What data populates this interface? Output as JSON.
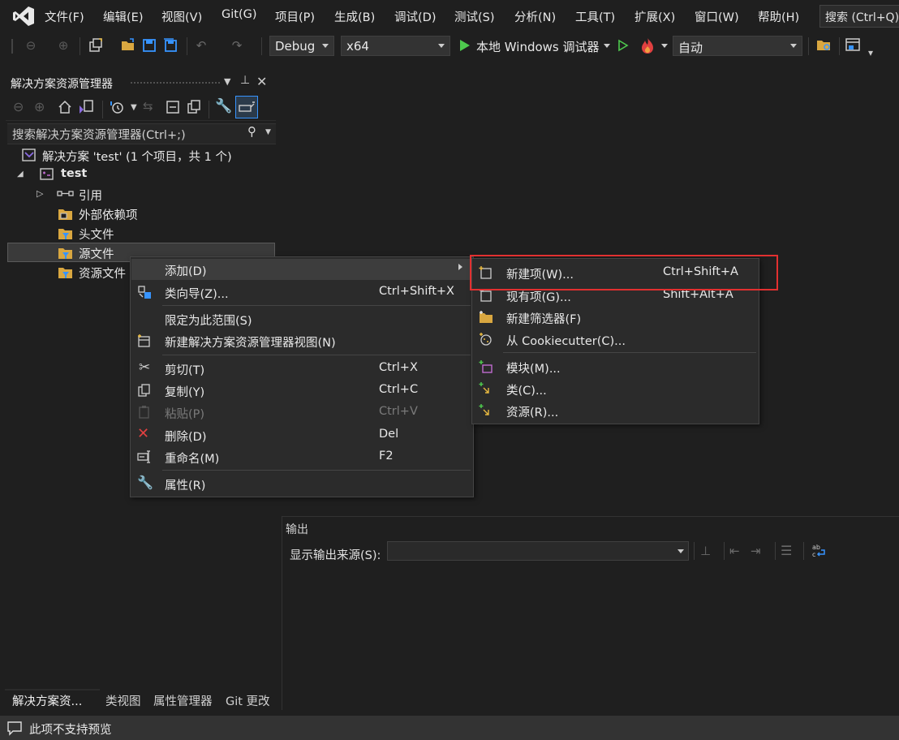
{
  "menubar": {
    "items": [
      "文件(F)",
      "编辑(E)",
      "视图(V)",
      "Git(G)",
      "项目(P)",
      "生成(B)",
      "调试(D)",
      "测试(S)",
      "分析(N)",
      "工具(T)",
      "扩展(X)",
      "窗口(W)",
      "帮助(H)"
    ],
    "search": "搜索 (Ctrl+Q)"
  },
  "toolbar": {
    "config": "Debug",
    "platform": "x64",
    "run_label": "本地 Windows 调试器",
    "auto": "自动"
  },
  "solution_explorer": {
    "title": "解决方案资源管理器",
    "search_placeholder": "搜索解决方案资源管理器(Ctrl+;)",
    "tree": {
      "solution": "解决方案 'test' (1 个项目，共 1 个)",
      "project": "test",
      "references": "引用",
      "external_deps": "外部依赖项",
      "headers": "头文件",
      "sources": "源文件",
      "resources": "资源文件"
    },
    "bottom_tabs": [
      "解决方案资...",
      "类视图",
      "属性管理器",
      "Git 更改"
    ]
  },
  "context_menu": {
    "add": "添加(D)",
    "class_wizard": "类向导(Z)...",
    "class_wizard_shortcut": "Ctrl+Shift+X",
    "scope": "限定为此范围(S)",
    "new_view": "新建解决方案资源管理器视图(N)",
    "cut": "剪切(T)",
    "cut_shortcut": "Ctrl+X",
    "copy": "复制(Y)",
    "copy_shortcut": "Ctrl+C",
    "paste": "粘贴(P)",
    "paste_shortcut": "Ctrl+V",
    "delete": "删除(D)",
    "delete_shortcut": "Del",
    "rename": "重命名(M)",
    "rename_shortcut": "F2",
    "properties": "属性(R)"
  },
  "submenu": {
    "new_item": "新建项(W)...",
    "new_item_shortcut": "Ctrl+Shift+A",
    "existing_item": "现有项(G)...",
    "existing_item_shortcut": "Shift+Alt+A",
    "new_filter": "新建筛选器(F)",
    "cookiecutter": "从 Cookiecutter(C)...",
    "module": "模块(M)...",
    "class": "类(C)...",
    "resource": "资源(R)..."
  },
  "output": {
    "title": "输出",
    "source_label": "显示输出来源(S):"
  },
  "status": {
    "text": "此项不支持预览"
  },
  "colors": {
    "background": "#1f1f1f",
    "menu": "#2b2b2b",
    "highlight": "#e23030",
    "accent": "#3794ff",
    "run": "#4ec94e"
  }
}
